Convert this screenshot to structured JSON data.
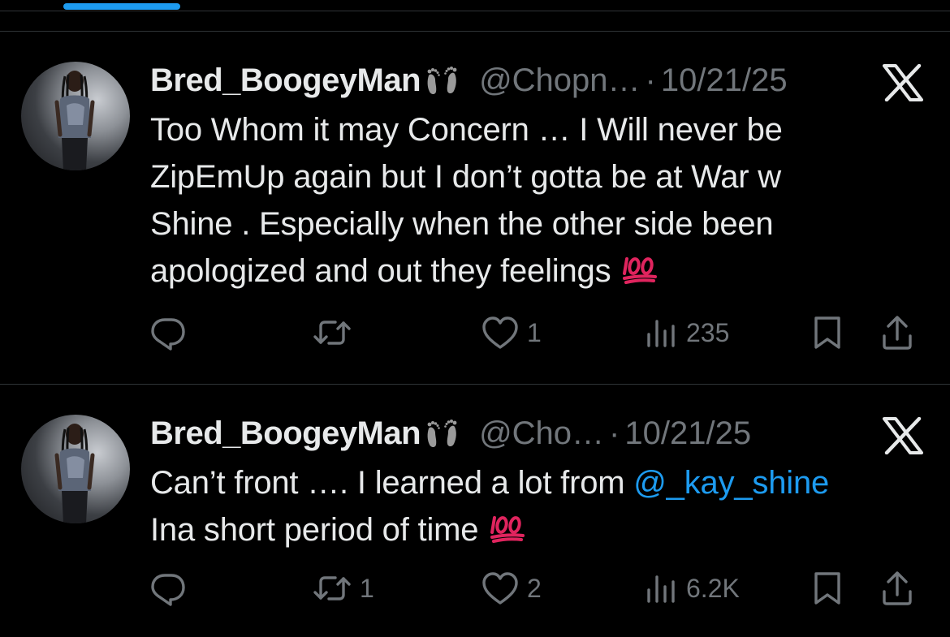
{
  "colors": {
    "background": "#000000",
    "text_primary": "#e7e9ea",
    "text_secondary": "#71767b",
    "accent": "#1d9bf0",
    "divider": "#2f3336",
    "hundred_emoji": "#e0245e"
  },
  "tweets": [
    {
      "display_name": "Bred_BoogeyMan",
      "name_emoji": "footprints-icon",
      "handle": "@Chopn…",
      "separator": "·",
      "date": "10/21/25",
      "source_icon": "x-logo-icon",
      "text_lines": [
        "Too Whom it may Concern … I Will never be",
        "ZipEmUp again but I don’t gotta be at War w",
        "Shine . Especially when the other side been",
        "apologized and out they feelings"
      ],
      "trailing_emoji": "hundred-points-icon",
      "actions": {
        "replies": "",
        "reposts": "",
        "likes": "1",
        "views": "235"
      }
    },
    {
      "display_name": "Bred_BoogeyMan",
      "name_emoji": "footprints-icon",
      "handle": "@Cho…",
      "separator": "·",
      "date": "10/21/25",
      "source_icon": "x-logo-icon",
      "text_line1_prefix": "Can’t front …. I learned a lot from ",
      "mention": "@_kay_shine",
      "text_line2": "Ina short period of time",
      "trailing_emoji": "hundred-points-icon",
      "actions": {
        "replies": "",
        "reposts": "1",
        "likes": "2",
        "views": "6.2K"
      }
    }
  ]
}
